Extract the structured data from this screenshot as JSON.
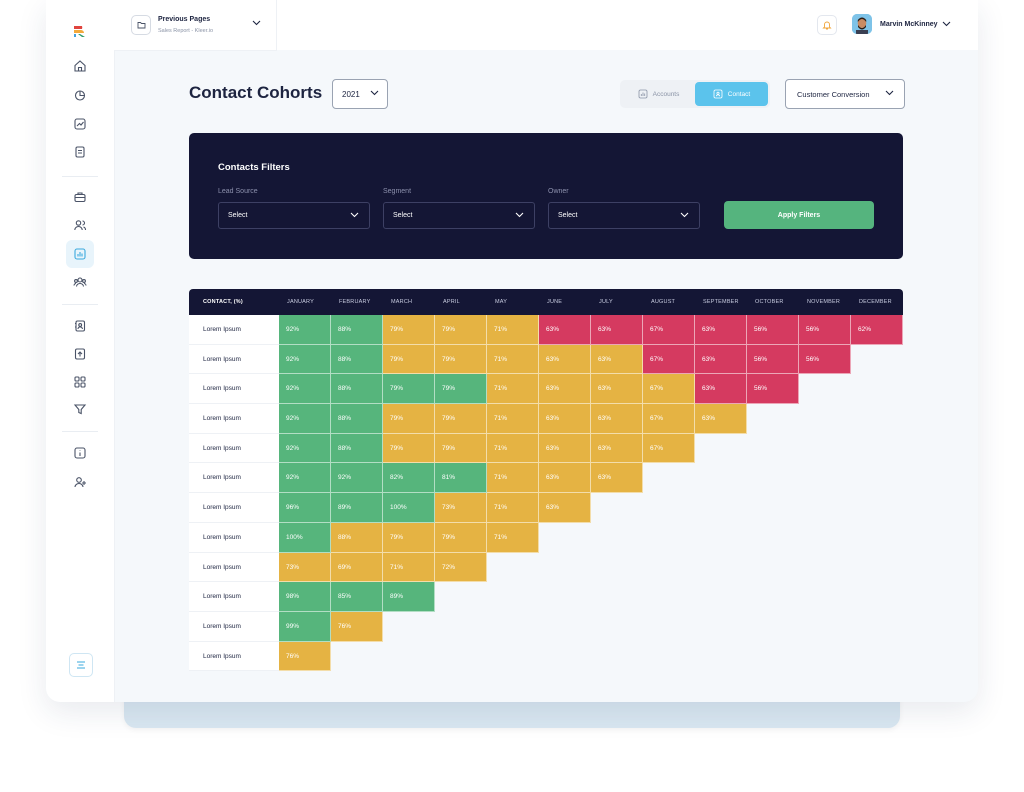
{
  "topbar": {
    "previous_pages_title": "Previous Pages",
    "previous_pages_sub": "Sales Report - Kleer.io",
    "user_name": "Marvin McKinney"
  },
  "page": {
    "title": "Contact Cohorts",
    "year": "2021",
    "toggle": {
      "accounts": "Accounts",
      "contact": "Contact",
      "active": "contact"
    },
    "conversion_select": "Customer Conversion"
  },
  "filters": {
    "title": "Contacts Filters",
    "lead_source_label": "Lead Source",
    "lead_source_value": "Select",
    "segment_label": "Segment",
    "segment_value": "Select",
    "owner_label": "Owner",
    "owner_value": "Select",
    "apply_label": "Apply Filters"
  },
  "table": {
    "header_first": "CONTACT, (%)",
    "months": [
      "JANUARY",
      "FEBRUARY",
      "MARCH",
      "APRIL",
      "MAY",
      "JUNE",
      "JULY",
      "AUGUST",
      "SEPTEMBER",
      "OCTOBER",
      "NOVEMBER",
      "DECEMBER"
    ],
    "rows": [
      {
        "label": "Lorem Ipsum",
        "cells": [
          [
            "92%",
            "g"
          ],
          [
            "88%",
            "g"
          ],
          [
            "79%",
            "y"
          ],
          [
            "79%",
            "y"
          ],
          [
            "71%",
            "y"
          ],
          [
            "63%",
            "r"
          ],
          [
            "63%",
            "r"
          ],
          [
            "67%",
            "r"
          ],
          [
            "63%",
            "r"
          ],
          [
            "56%",
            "r"
          ],
          [
            "56%",
            "r"
          ],
          [
            "62%",
            "r"
          ]
        ]
      },
      {
        "label": "Lorem Ipsum",
        "cells": [
          [
            "92%",
            "g"
          ],
          [
            "88%",
            "g"
          ],
          [
            "79%",
            "y"
          ],
          [
            "79%",
            "y"
          ],
          [
            "71%",
            "y"
          ],
          [
            "63%",
            "y"
          ],
          [
            "63%",
            "y"
          ],
          [
            "67%",
            "r"
          ],
          [
            "63%",
            "r"
          ],
          [
            "56%",
            "r"
          ],
          [
            "56%",
            "r"
          ]
        ]
      },
      {
        "label": "Lorem Ipsum",
        "cells": [
          [
            "92%",
            "g"
          ],
          [
            "88%",
            "g"
          ],
          [
            "79%",
            "g"
          ],
          [
            "79%",
            "g"
          ],
          [
            "71%",
            "y"
          ],
          [
            "63%",
            "y"
          ],
          [
            "63%",
            "y"
          ],
          [
            "67%",
            "y"
          ],
          [
            "63%",
            "r"
          ],
          [
            "56%",
            "r"
          ]
        ]
      },
      {
        "label": "Lorem Ipsum",
        "cells": [
          [
            "92%",
            "g"
          ],
          [
            "88%",
            "g"
          ],
          [
            "79%",
            "y"
          ],
          [
            "79%",
            "y"
          ],
          [
            "71%",
            "y"
          ],
          [
            "63%",
            "y"
          ],
          [
            "63%",
            "y"
          ],
          [
            "67%",
            "y"
          ],
          [
            "63%",
            "y"
          ]
        ]
      },
      {
        "label": "Lorem Ipsum",
        "cells": [
          [
            "92%",
            "g"
          ],
          [
            "88%",
            "g"
          ],
          [
            "79%",
            "y"
          ],
          [
            "79%",
            "y"
          ],
          [
            "71%",
            "y"
          ],
          [
            "63%",
            "y"
          ],
          [
            "63%",
            "y"
          ],
          [
            "67%",
            "y"
          ]
        ]
      },
      {
        "label": "Lorem Ipsum",
        "cells": [
          [
            "92%",
            "g"
          ],
          [
            "92%",
            "g"
          ],
          [
            "82%",
            "g"
          ],
          [
            "81%",
            "g"
          ],
          [
            "71%",
            "y"
          ],
          [
            "63%",
            "y"
          ],
          [
            "63%",
            "y"
          ]
        ]
      },
      {
        "label": "Lorem Ipsum",
        "cells": [
          [
            "96%",
            "g"
          ],
          [
            "89%",
            "g"
          ],
          [
            "100%",
            "g"
          ],
          [
            "73%",
            "y"
          ],
          [
            "71%",
            "y"
          ],
          [
            "63%",
            "y"
          ]
        ]
      },
      {
        "label": "Lorem Ipsum",
        "cells": [
          [
            "100%",
            "g"
          ],
          [
            "88%",
            "y"
          ],
          [
            "79%",
            "y"
          ],
          [
            "79%",
            "y"
          ],
          [
            "71%",
            "y"
          ]
        ]
      },
      {
        "label": "Lorem Ipsum",
        "cells": [
          [
            "73%",
            "y"
          ],
          [
            "69%",
            "y"
          ],
          [
            "71%",
            "y"
          ],
          [
            "72%",
            "y"
          ]
        ]
      },
      {
        "label": "Lorem Ipsum",
        "cells": [
          [
            "98%",
            "g"
          ],
          [
            "85%",
            "g"
          ],
          [
            "89%",
            "g"
          ]
        ]
      },
      {
        "label": "Lorem Ipsum",
        "cells": [
          [
            "99%",
            "g"
          ],
          [
            "76%",
            "y"
          ]
        ]
      },
      {
        "label": "Lorem Ipsum",
        "cells": [
          [
            "76%",
            "y"
          ]
        ]
      }
    ]
  },
  "colors": {
    "green": "#56b57c",
    "yellow": "#e5b343",
    "red": "#d53a60",
    "navy": "#141635",
    "accent": "#5bc3ec"
  }
}
